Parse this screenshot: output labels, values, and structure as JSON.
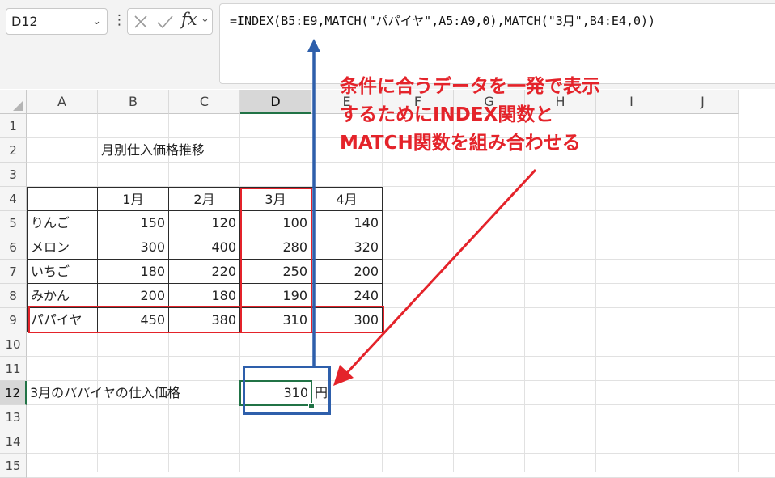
{
  "name_box": {
    "value": "D12"
  },
  "formula_bar": {
    "formula": "=INDEX(B5:E9,MATCH(\"パパイヤ\",A5:A9,0),MATCH(\"3月\",B4:E4,0))",
    "icons": [
      "cancel-icon",
      "enter-icon",
      "fx-icon"
    ]
  },
  "columns": [
    "A",
    "B",
    "C",
    "D",
    "E",
    "F",
    "G",
    "H",
    "I",
    "J"
  ],
  "rows": [
    "1",
    "2",
    "3",
    "4",
    "5",
    "6",
    "7",
    "8",
    "9",
    "10",
    "11",
    "12",
    "13",
    "14",
    "15"
  ],
  "selected": {
    "column": "D",
    "row": "12"
  },
  "sheet": {
    "title": "月別仕入価格推移",
    "months": [
      "1月",
      "2月",
      "3月",
      "4月"
    ],
    "items": [
      {
        "name": "りんご",
        "values": [
          "150",
          "120",
          "100",
          "140"
        ]
      },
      {
        "name": "メロン",
        "values": [
          "300",
          "400",
          "280",
          "320"
        ]
      },
      {
        "name": "いちご",
        "values": [
          "180",
          "220",
          "250",
          "200"
        ]
      },
      {
        "name": "みかん",
        "values": [
          "200",
          "180",
          "190",
          "240"
        ]
      },
      {
        "name": "パパイヤ",
        "values": [
          "450",
          "380",
          "310",
          "300"
        ]
      }
    ],
    "result_label": "3月のパパイヤの仕入価格",
    "result_value": "310",
    "result_unit": "円"
  },
  "annotation": {
    "lines": [
      "条件に合うデータを一発で表示",
      "するためにINDEX関数と",
      "MATCH関数を組み合わせる"
    ],
    "color": "#e4232a"
  },
  "colors": {
    "highlight_red": "#e4232a",
    "result_blue": "#2e5fab",
    "excel_green": "#217346"
  }
}
